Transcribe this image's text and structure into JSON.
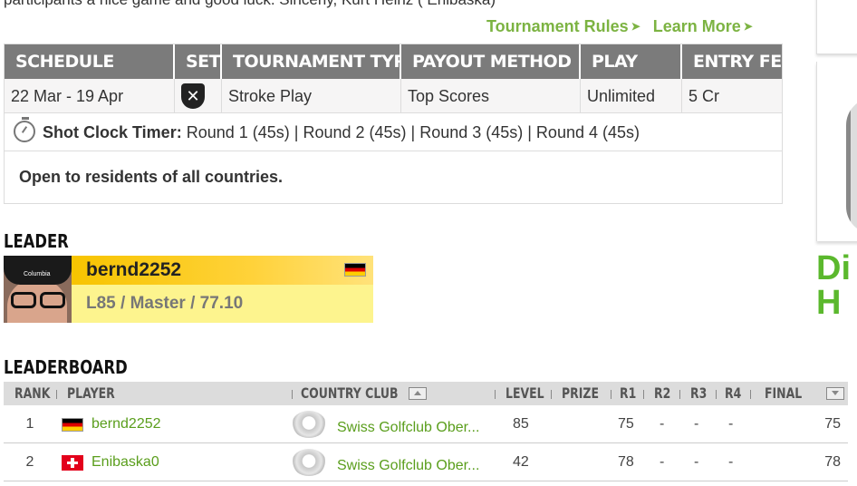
{
  "intro_text": "participants a nice game and good luck. Sincerly, Kurt Heinz ( Enibaska)",
  "links": [
    {
      "label": "Tournament Rules",
      "arrow": "➤"
    },
    {
      "label": "Learn More",
      "arrow": "➤"
    }
  ],
  "schedule": {
    "headers": [
      "SCHEDULE",
      "SET",
      "TOURNAMENT TYPE",
      "PAYOUT METHOD",
      "PLAY",
      "ENTRY FEE"
    ],
    "row": {
      "schedule": "22 Mar - 19 Apr",
      "set_icon": "crossed-clubs-shield-icon",
      "set_glyph": "✕",
      "type": "Stroke Play",
      "payout": "Top Scores",
      "play": "Unlimited",
      "fee": "5 Cr"
    },
    "shot_clock_label": "Shot Clock Timer:",
    "shot_clock_value": " Round 1 (45s) | Round 2 (45s) | Round 3 (45s) | Round 4 (45s)",
    "eligibility": "Open to residents of all countries."
  },
  "leader": {
    "section_title": "LEADER",
    "name": "bernd2252",
    "flag": "germany-flag-icon",
    "stats": "L85 / Master / 77.10",
    "cap_text": "Columbia"
  },
  "leaderboard": {
    "section_title": "LEADERBOARD",
    "headers": {
      "rank": "RANK",
      "player": "PLAYER",
      "club": "COUNTRY CLUB",
      "level": "LEVEL",
      "prize": "PRIZE",
      "r1": "R1",
      "r2": "R2",
      "r3": "R3",
      "r4": "R4",
      "final": "FINAL"
    },
    "rows": [
      {
        "rank": "1",
        "flag": "germany-flag-icon",
        "player": "bernd2252",
        "club": "Swiss Golfclub Ober...",
        "level": "85",
        "r1": "75",
        "r2": "-",
        "r3": "-",
        "r4": "-",
        "final": "75"
      },
      {
        "rank": "2",
        "flag": "switzerland-flag-icon",
        "player": "Enibaska0",
        "club": "Swiss Golfclub Ober...",
        "level": "42",
        "r1": "78",
        "r2": "-",
        "r3": "-",
        "r4": "-",
        "final": "78"
      }
    ]
  },
  "sidebar": {
    "ad_text_line1": "Di",
    "ad_text_line2": "H"
  },
  "colors": {
    "accent_green": "#7cb342",
    "header_gray": "#7b7b7b",
    "leader_gold": "#f7c400",
    "leader_yellow": "#fdf48e"
  }
}
